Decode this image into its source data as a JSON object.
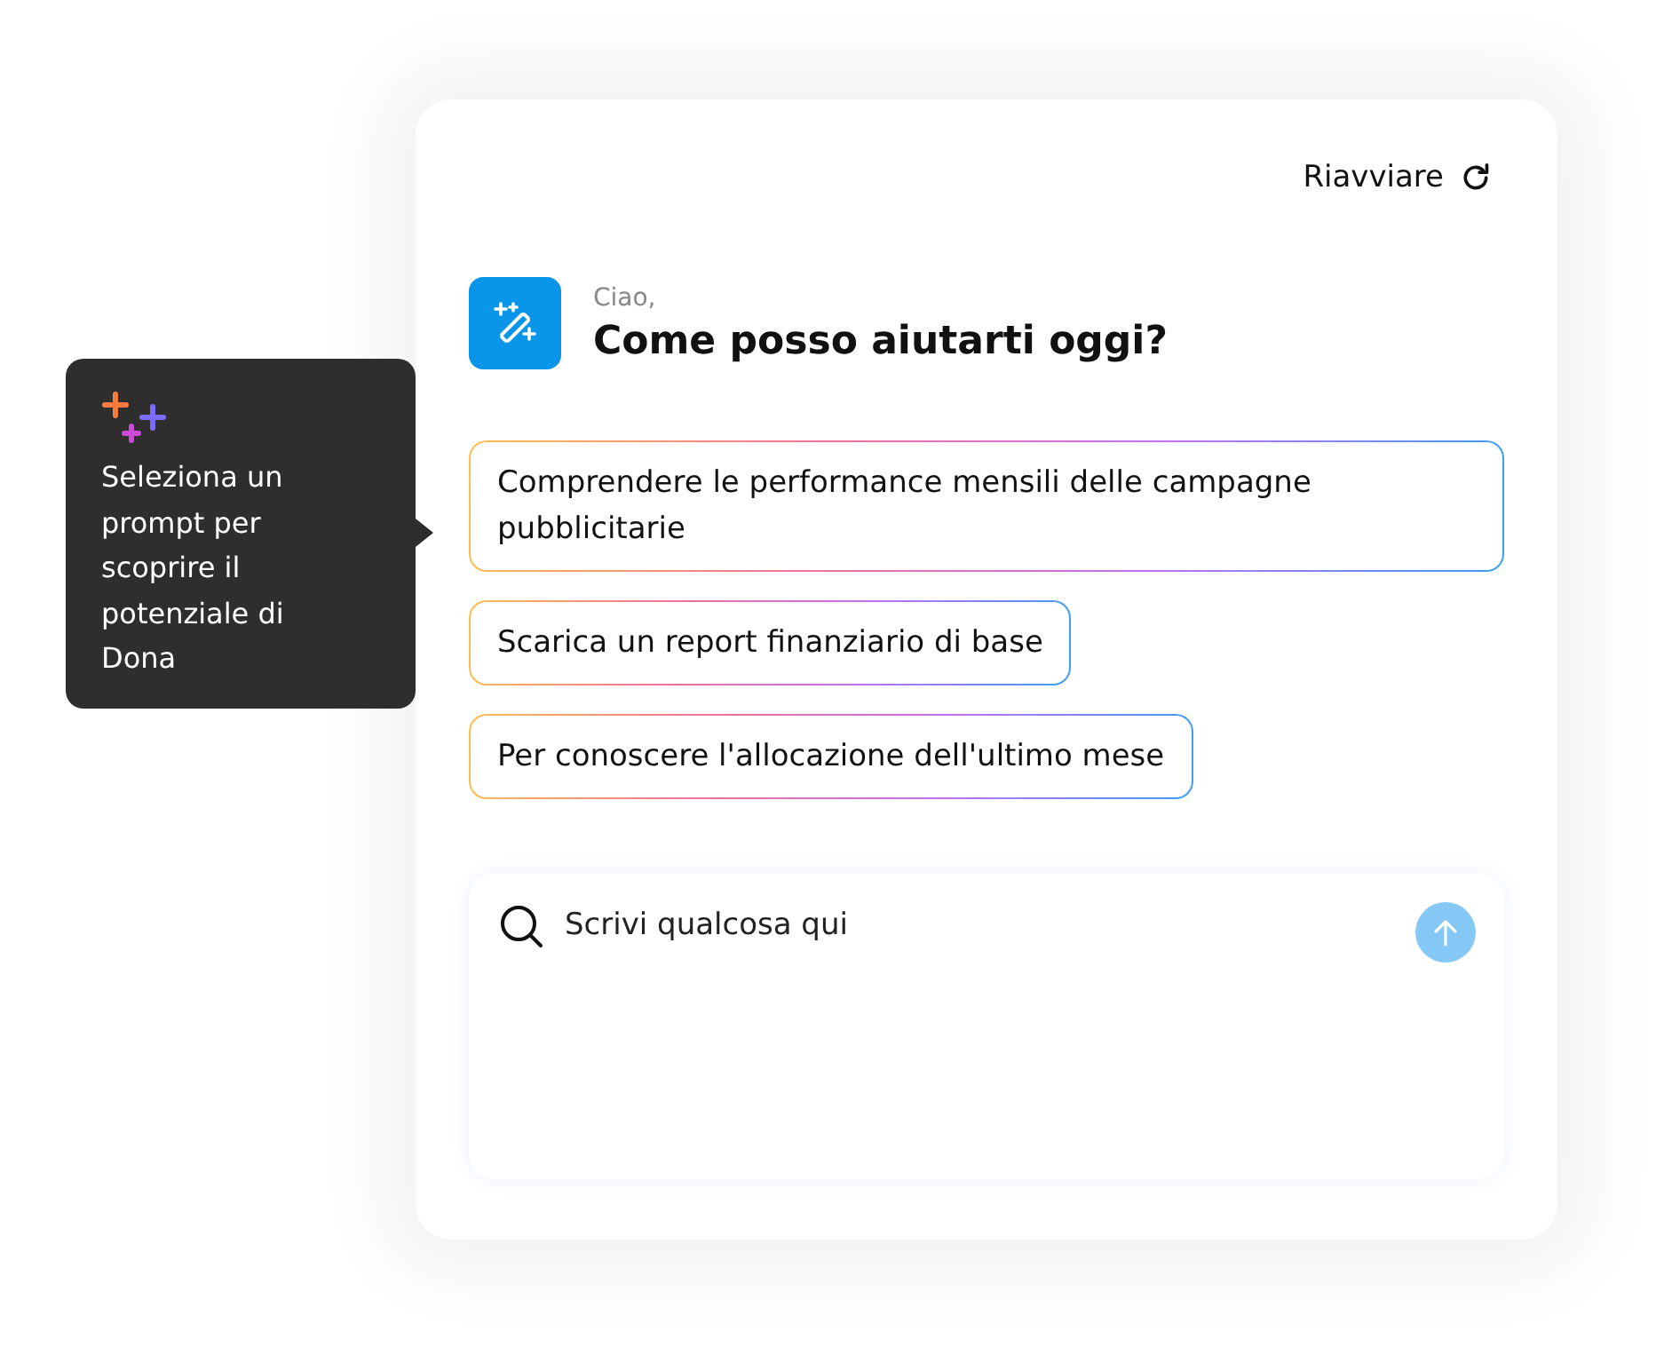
{
  "header": {
    "restart_label": "Riavviare"
  },
  "greeting": {
    "hello": "Ciao,",
    "question": "Come posso aiutarti oggi?"
  },
  "prompts": [
    {
      "text": "Comprendere le performance mensili delle campagne pubblicitarie"
    },
    {
      "text": "Scarica un report finanziario di base"
    },
    {
      "text": "Per conoscere l'allocazione dell'ultimo mese"
    }
  ],
  "input": {
    "placeholder": "Scrivi qualcosa qui",
    "send_disabled": true
  },
  "tooltip": {
    "text": "Seleziona un prompt per scoprire il potenziale di Dona"
  }
}
